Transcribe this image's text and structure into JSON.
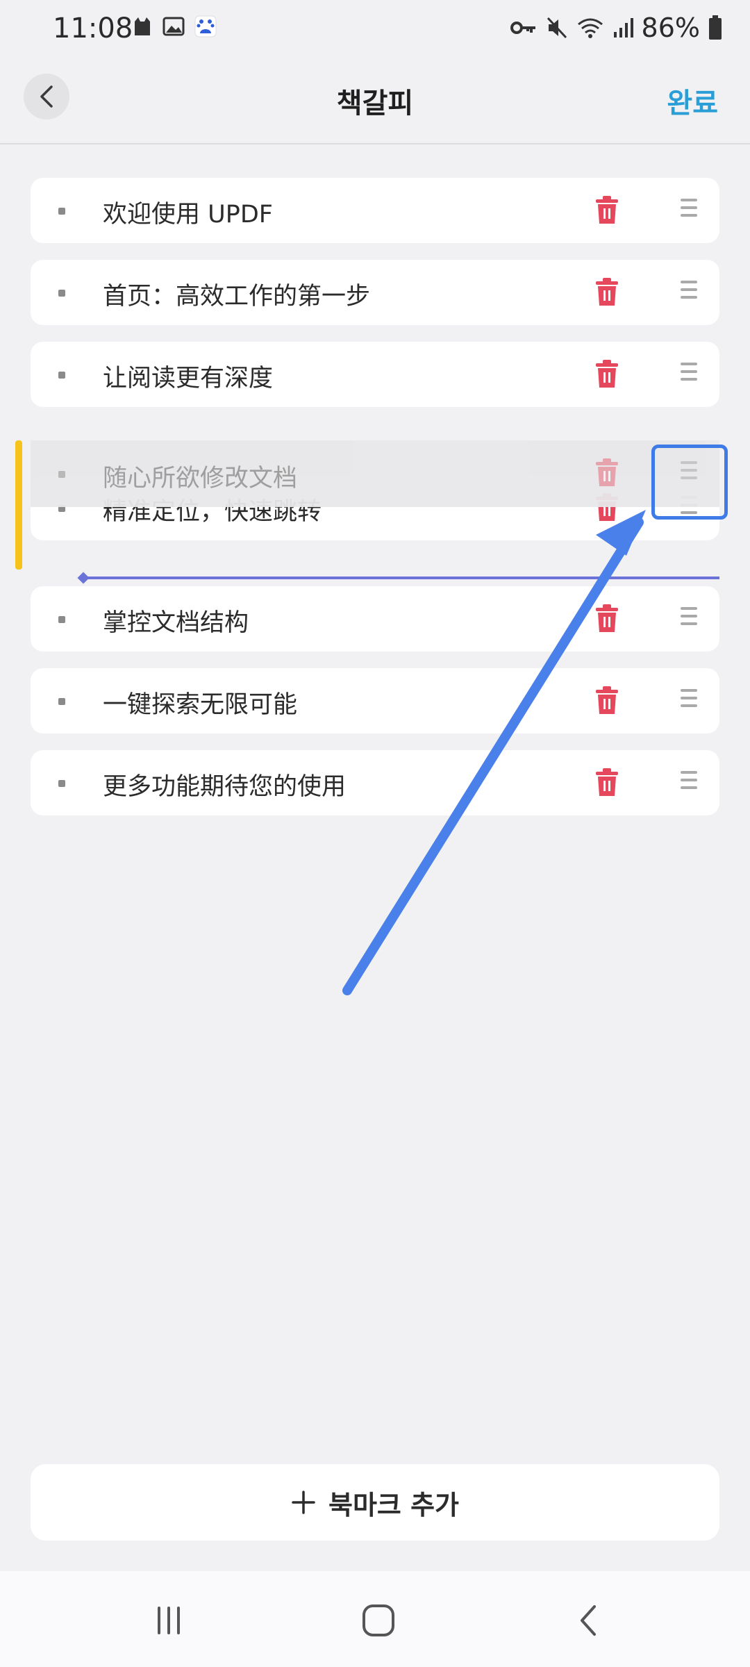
{
  "status_bar": {
    "time": "11:08",
    "battery": "86%"
  },
  "header": {
    "title": "책갈피",
    "done_label": "완료"
  },
  "bookmarks": [
    {
      "label": "欢迎使用 UPDF"
    },
    {
      "label": "首页：高效工作的第一步"
    },
    {
      "label": "让阅读更有深度"
    },
    {
      "label": "精准定位，快速跳转"
    },
    {
      "label": "掌控文档结构"
    },
    {
      "label": "一键探索无限可能"
    },
    {
      "label": "更多功能期待您的使用"
    }
  ],
  "dragged_bookmark": {
    "label": "随心所欲修改文档"
  },
  "add_bookmark": {
    "label": "북마크 추가"
  },
  "colors": {
    "accent": "#2a9ed6",
    "delete": "#e5475c",
    "drop_line": "#6b73d9",
    "drag_indicator": "#f5c31a",
    "annotation": "#3f7be6"
  }
}
